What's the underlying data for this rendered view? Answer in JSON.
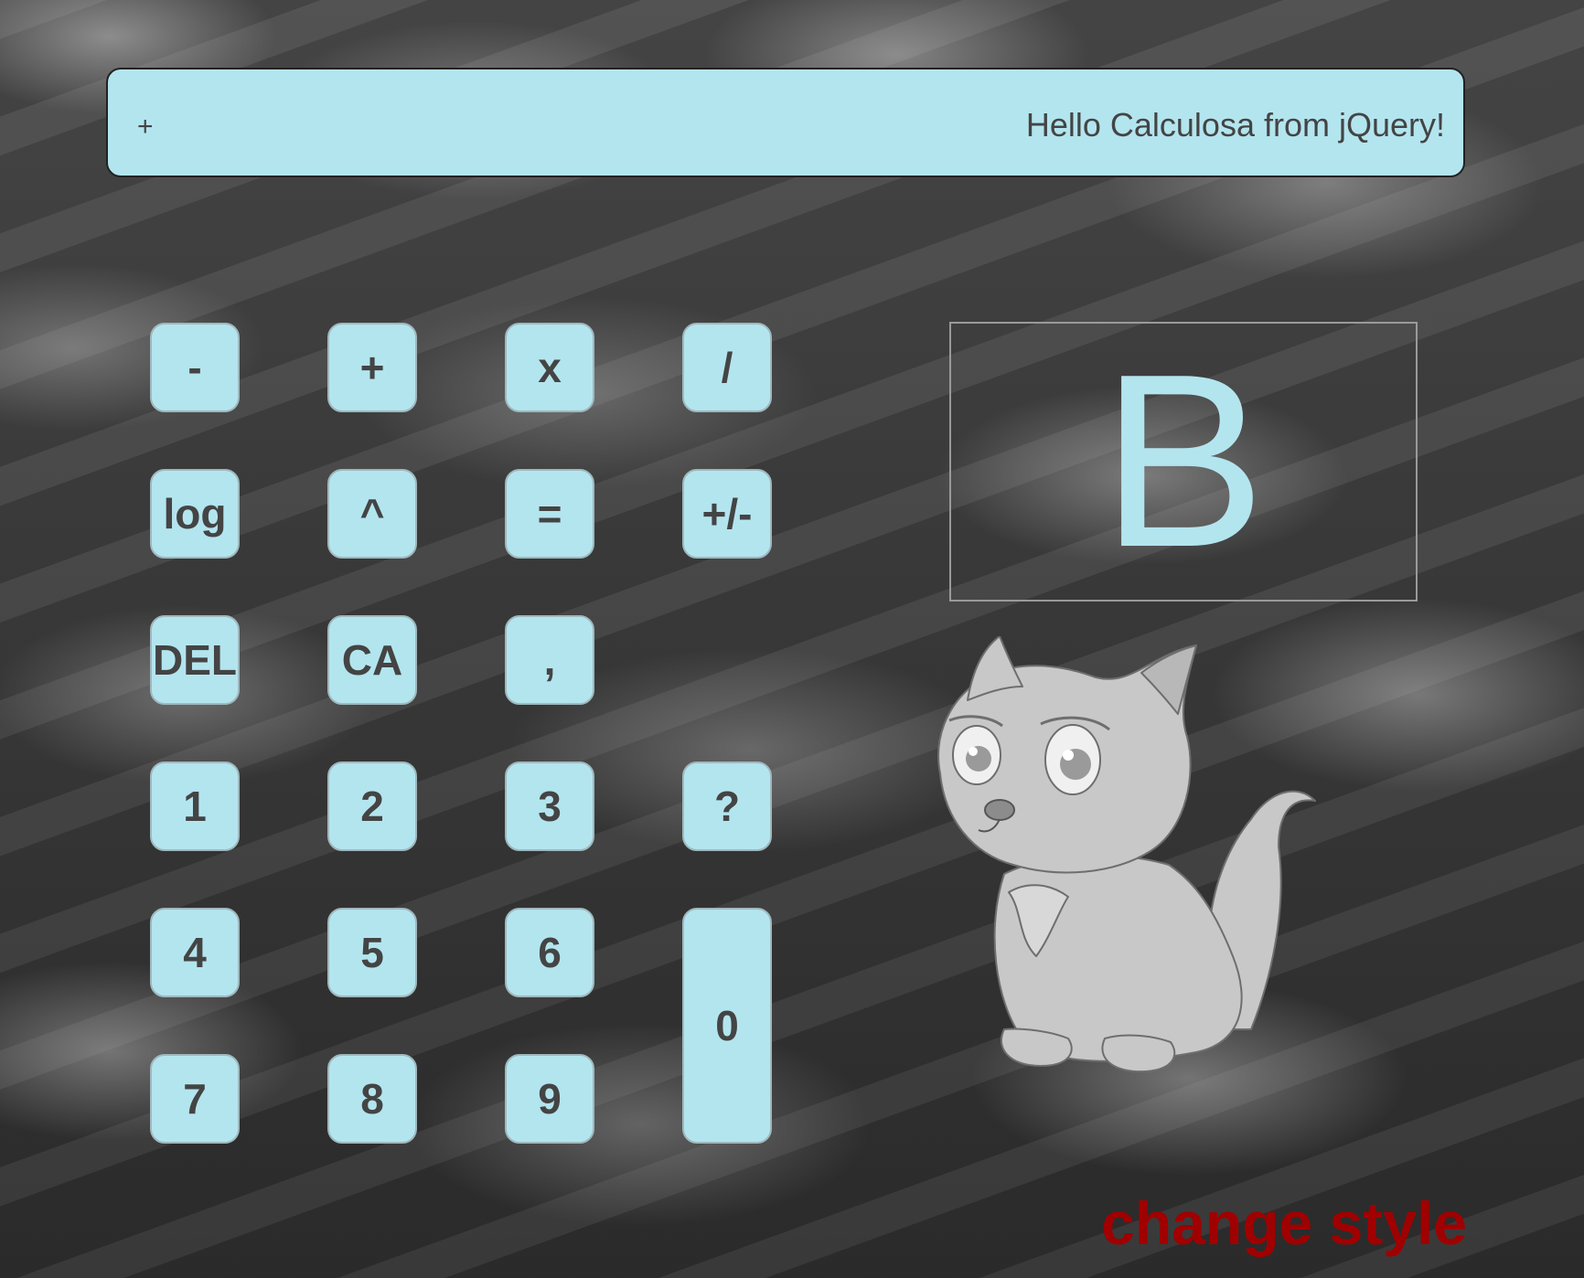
{
  "display": {
    "operator": "+",
    "message": "Hello Calculosa from jQuery!"
  },
  "keys": {
    "minus": "-",
    "plus": "+",
    "multiply": "x",
    "divide": "/",
    "log": "log",
    "power": "^",
    "equals": "=",
    "sign": "+/-",
    "del": "DEL",
    "clear_all": "CA",
    "comma": ",",
    "one": "1",
    "two": "2",
    "three": "3",
    "help": "?",
    "four": "4",
    "five": "5",
    "six": "6",
    "zero": "0",
    "seven": "7",
    "eight": "8",
    "nine": "9"
  },
  "mode_indicator": {
    "letter": "B"
  },
  "mascot": {
    "icon": "fox-cub-mascot"
  },
  "style_link": {
    "label": "change style"
  },
  "colors": {
    "key_background": "#b3e5ef",
    "key_text": "#444444",
    "link": "#a00000"
  }
}
